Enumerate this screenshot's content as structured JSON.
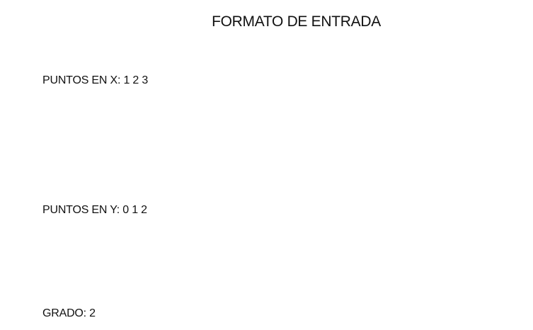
{
  "document": {
    "title": "FORMATO DE ENTRADA",
    "lines": {
      "x_points": "PUNTOS EN X: 1 2 3",
      "y_points": "PUNTOS EN Y: 0 1 2",
      "degree": "GRADO: 2"
    }
  }
}
